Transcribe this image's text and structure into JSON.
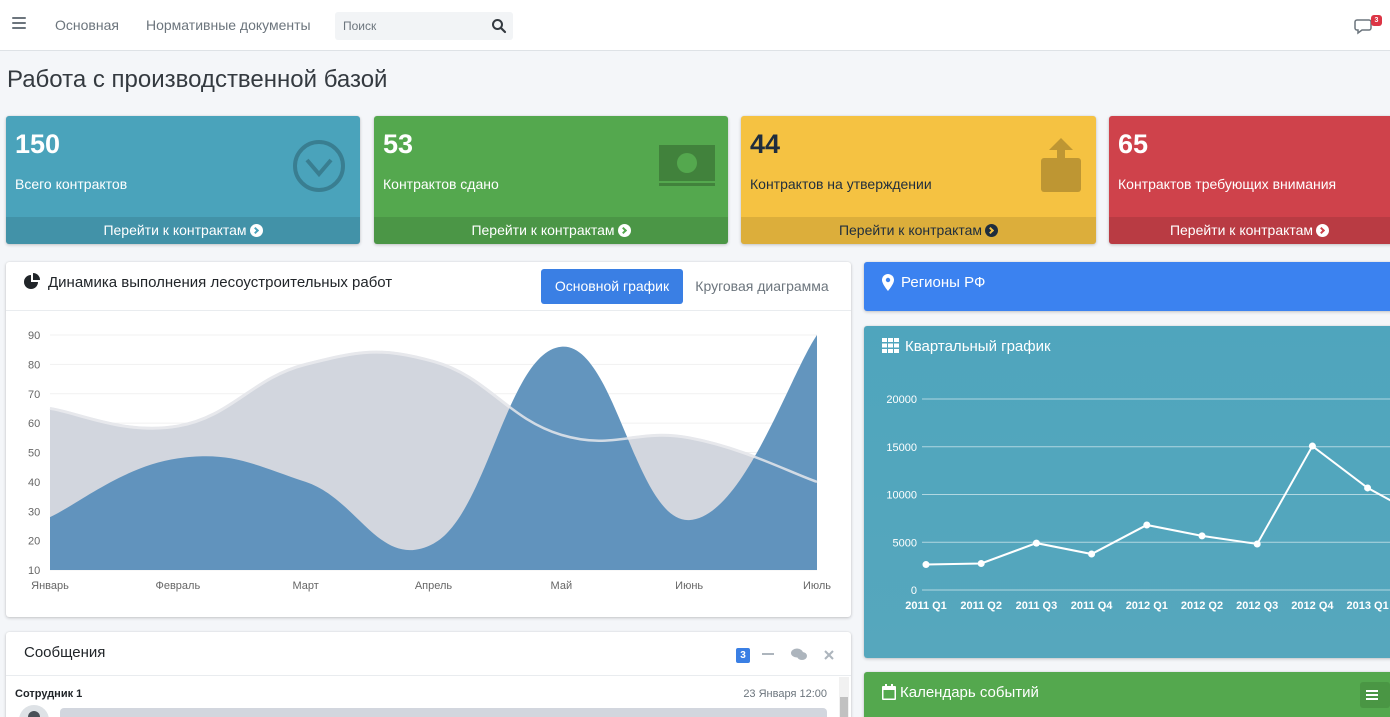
{
  "nav": {
    "links": [
      "Основная",
      "Нормативные документы"
    ],
    "search_placeholder": "Поиск",
    "messages_count": "3"
  },
  "page": {
    "title": "Работа с производственной базой"
  },
  "stats": [
    {
      "value": "150",
      "label": "Всего контрактов",
      "link": "Перейти к контрактам",
      "color": "#4aa3bb",
      "icon": "check-circle-icon"
    },
    {
      "value": "53",
      "label": "Контрактов сдано",
      "link": "Перейти к контрактам",
      "color": "#54a84e",
      "icon": "money-bill-icon"
    },
    {
      "value": "44",
      "label": "Контрактов на утверждении",
      "link": "Перейти к контрактам",
      "color": "#f5c242",
      "icon": "upload-icon"
    },
    {
      "value": "65",
      "label": "Контрактов требующих внимания",
      "link": "Перейти к контрактам",
      "color": "#cf424b",
      "icon": "warning-icon"
    }
  ],
  "dynamics": {
    "title": "Динамика выполнения лесоустроительных работ",
    "tabs": [
      "Основной график",
      "Круговая диаграмма"
    ]
  },
  "regions": {
    "title": "Регионы РФ"
  },
  "quarterly": {
    "title": "Квартальный график"
  },
  "messages": {
    "title": "Сообщения",
    "count": "3",
    "items": [
      {
        "author": "Сотрудник 1",
        "time": "23 Января 12:00"
      }
    ]
  },
  "calendar": {
    "title": "Календарь событий"
  },
  "chart_data": [
    {
      "type": "area",
      "categories": [
        "Январь",
        "Февраль",
        "Март",
        "Апрель",
        "Май",
        "Июнь",
        "Июль"
      ],
      "ylim": [
        10,
        90
      ],
      "yticks": [
        10,
        20,
        30,
        40,
        50,
        60,
        70,
        80,
        90
      ],
      "series": [
        {
          "values": [
            65,
            59,
            80,
            81,
            56,
            55,
            40
          ],
          "color": "#d2d6de"
        },
        {
          "values": [
            28,
            48,
            40,
            19,
            86,
            27,
            90
          ],
          "color": "#5b8fba"
        }
      ]
    },
    {
      "type": "line",
      "categories": [
        "2011 Q1",
        "2011 Q2",
        "2011 Q3",
        "2011 Q4",
        "2012 Q1",
        "2012 Q2",
        "2012 Q3",
        "2012 Q4",
        "2013 Q1"
      ],
      "values": [
        2666,
        2778,
        4912,
        3767,
        6810,
        5670,
        4820,
        15073,
        10687
      ],
      "ylim": [
        0,
        20000
      ],
      "yticks": [
        0,
        5000,
        10000,
        15000,
        20000
      ],
      "grid": true
    }
  ]
}
